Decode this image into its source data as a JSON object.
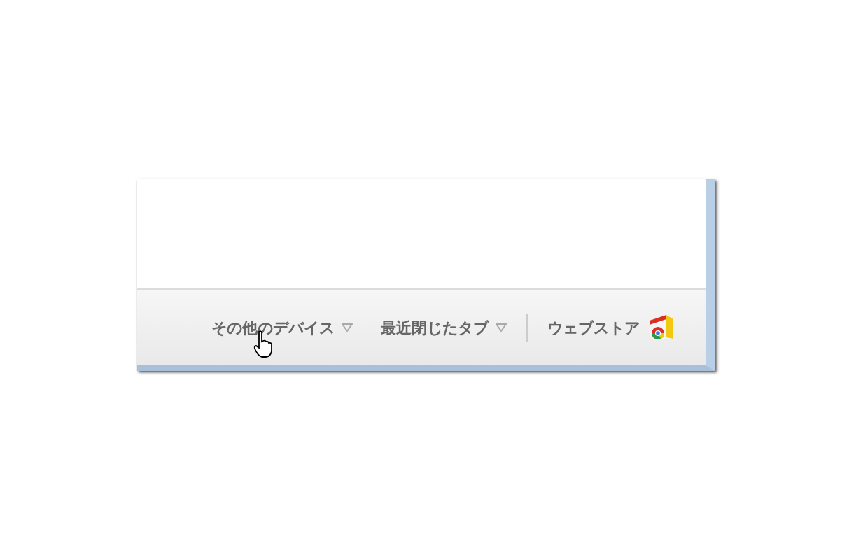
{
  "footer": {
    "menus": [
      {
        "label": "その他のデバイス",
        "kind": "dropdown"
      },
      {
        "label": "最近閉じたタブ",
        "kind": "dropdown"
      },
      {
        "label": "ウェブストア",
        "kind": "store"
      }
    ]
  }
}
